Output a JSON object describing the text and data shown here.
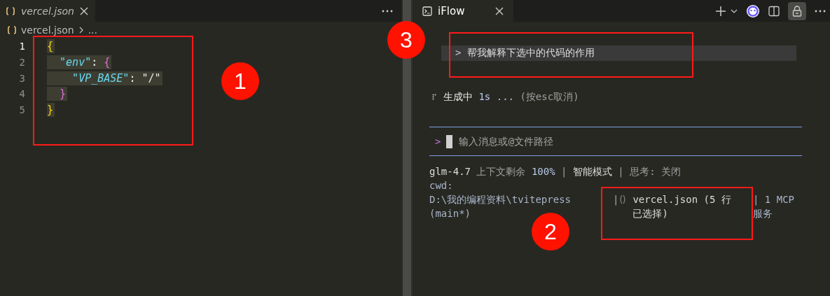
{
  "left_pane": {
    "tab": {
      "label": "vercel.json",
      "selected": true,
      "preview": true
    },
    "breadcrumb": [
      "vercel.json",
      "..."
    ],
    "code_lines": [
      {
        "number": "1",
        "active": true,
        "tokens": [
          {
            "text": "{",
            "kind": "brace1"
          }
        ]
      },
      {
        "number": "2",
        "active": false,
        "tokens": [
          {
            "text": "  \"env\"",
            "kind": "key"
          },
          {
            "text": ": ",
            "kind": "punct"
          },
          {
            "text": "{",
            "kind": "brace2"
          }
        ]
      },
      {
        "number": "3",
        "active": false,
        "tokens": [
          {
            "text": "    \"VP_BASE\"",
            "kind": "key"
          },
          {
            "text": ": ",
            "kind": "punct"
          },
          {
            "text": "\"/\"",
            "kind": "string"
          }
        ]
      },
      {
        "number": "4",
        "active": false,
        "tokens": [
          {
            "text": "  }",
            "kind": "brace2"
          }
        ]
      },
      {
        "number": "5",
        "active": false,
        "tokens": [
          {
            "text": "}",
            "kind": "brace1"
          }
        ]
      }
    ]
  },
  "right_pane": {
    "tab": {
      "label": "iFlow",
      "selected": true
    },
    "user_message": {
      "prompt": ">",
      "text": "帮我解释下选中的代码的作用"
    },
    "status": [
      {
        "text": "生成中 ",
        "kind": "strong"
      },
      {
        "text": "1s ...",
        "kind": "accent"
      },
      {
        "text": " (按esc取消)",
        "kind": "dim"
      }
    ],
    "input": {
      "prompt": ">",
      "placeholder": "输入消息或@文件路径"
    },
    "footer_line": [
      {
        "text": "glm-4.7",
        "kind": "strong"
      },
      {
        "text": " 上下文剩余 ",
        "kind": "dim"
      },
      {
        "text": "100%",
        "kind": "accent"
      },
      {
        "text": " | ",
        "kind": "dim"
      },
      {
        "text": "智能模式",
        "kind": "strong"
      },
      {
        "text": " | 思考: 关闭",
        "kind": "dim"
      }
    ],
    "cwd": "cwd: D:\\我的编程资料\\tvitepress (main*)",
    "file_separator": "|",
    "selection": "vercel.json (5 行已选择)",
    "mcp": "| 1 MCP 服务"
  },
  "annotations": [
    {
      "label": "1"
    },
    {
      "label": "2"
    },
    {
      "label": "3"
    }
  ]
}
